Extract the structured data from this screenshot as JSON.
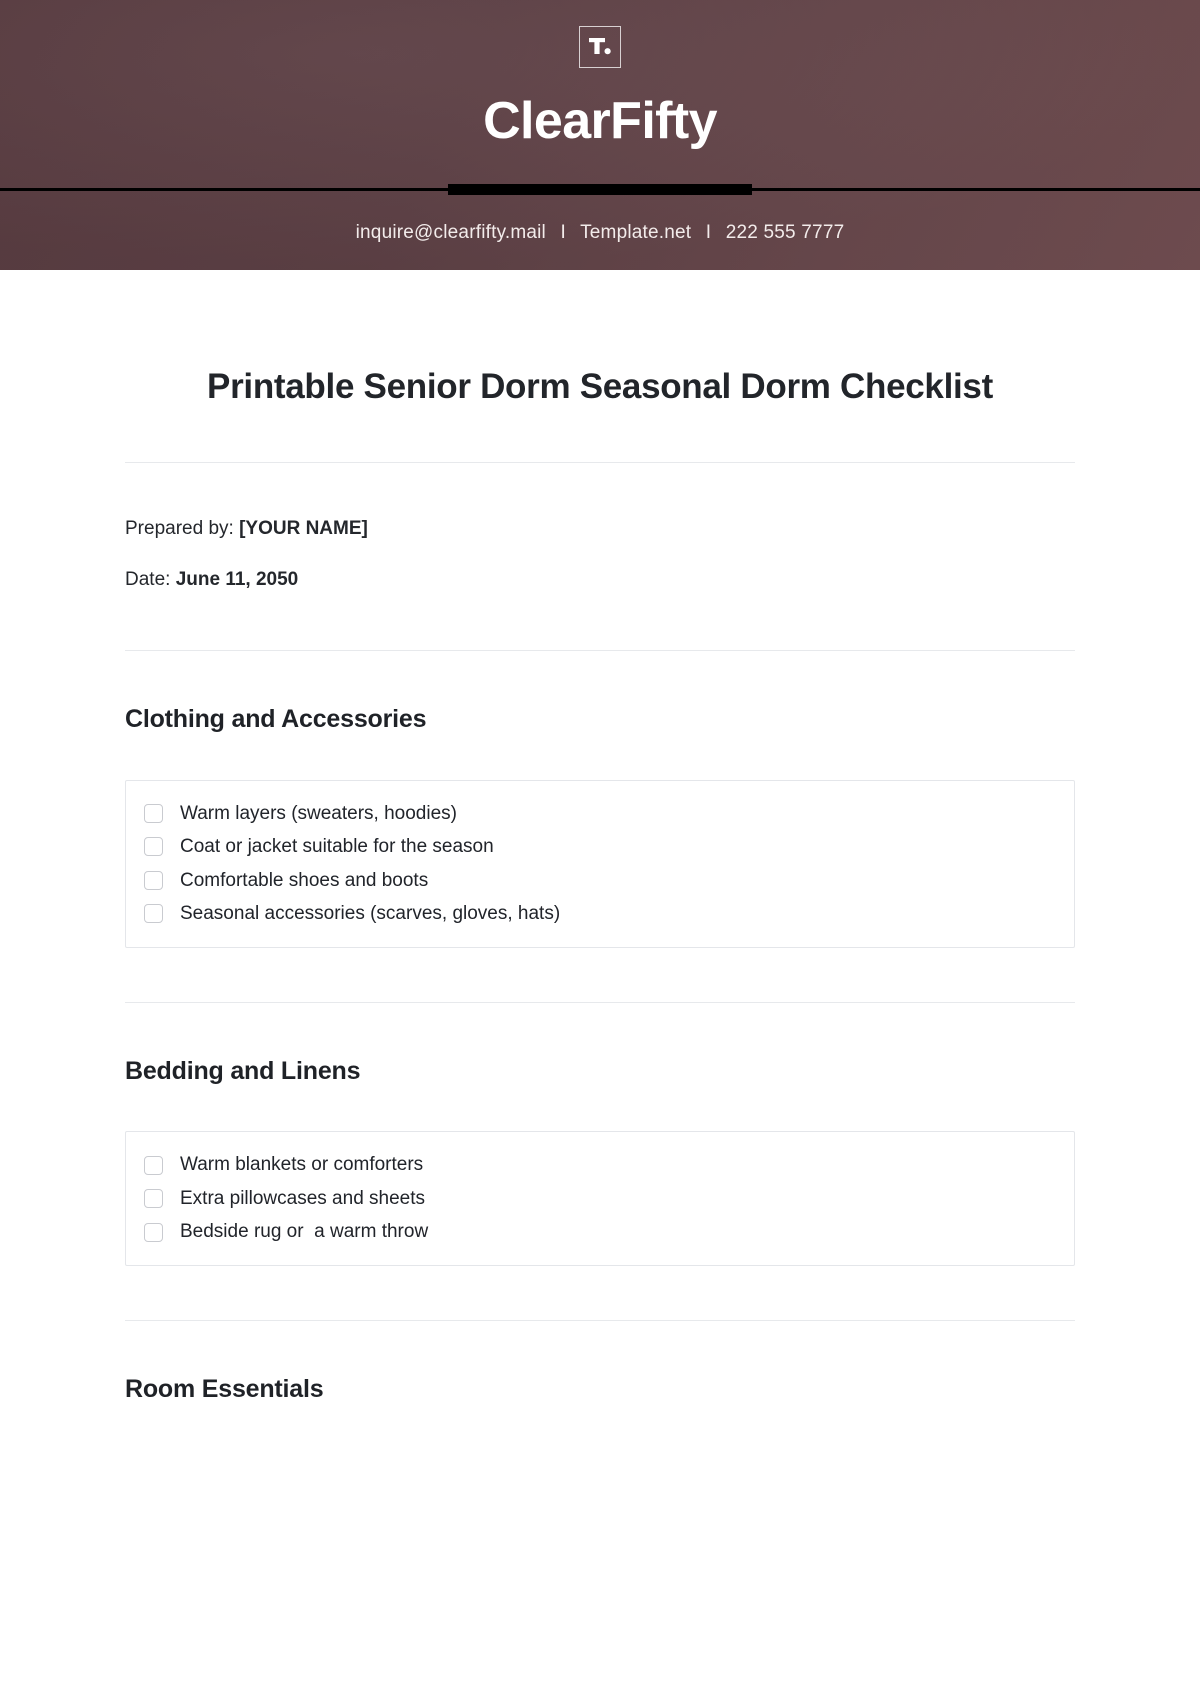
{
  "brand": {
    "logo_icon": "template-t-logo-icon",
    "logo_text": "T.",
    "name": "ClearFifty",
    "contact": {
      "email": "inquire@clearfifty.mail",
      "website": "Template.net",
      "phone": "222 555 7777",
      "separator": "I"
    },
    "colors": {
      "header_bg_dark": "#5a3d42",
      "header_bg_light": "#734f52",
      "rule": "#000000",
      "text_on_header": "#ffffff"
    }
  },
  "document": {
    "title": "Printable Senior Dorm Seasonal Dorm Checklist",
    "meta": [
      {
        "label": "Prepared by:",
        "value": "[YOUR NAME]"
      },
      {
        "label": "Date:",
        "value": "June 11, 2050"
      }
    ]
  },
  "sections": [
    {
      "heading": "Clothing and Accessories",
      "items": [
        {
          "label": "Warm layers (sweaters, hoodies)",
          "checked": false
        },
        {
          "label": "Coat or jacket suitable for the season",
          "checked": false
        },
        {
          "label": "Comfortable shoes and boots",
          "checked": false
        },
        {
          "label": "Seasonal accessories (scarves, gloves, hats)",
          "checked": false
        }
      ]
    },
    {
      "heading": "Bedding and Linens",
      "items": [
        {
          "label": "Warm blankets or comforters",
          "checked": false
        },
        {
          "label": "Extra pillowcases and sheets",
          "checked": false
        },
        {
          "label": "Bedside rug or  a warm throw",
          "checked": false
        }
      ]
    },
    {
      "heading": "Room Essentials",
      "items": []
    }
  ]
}
